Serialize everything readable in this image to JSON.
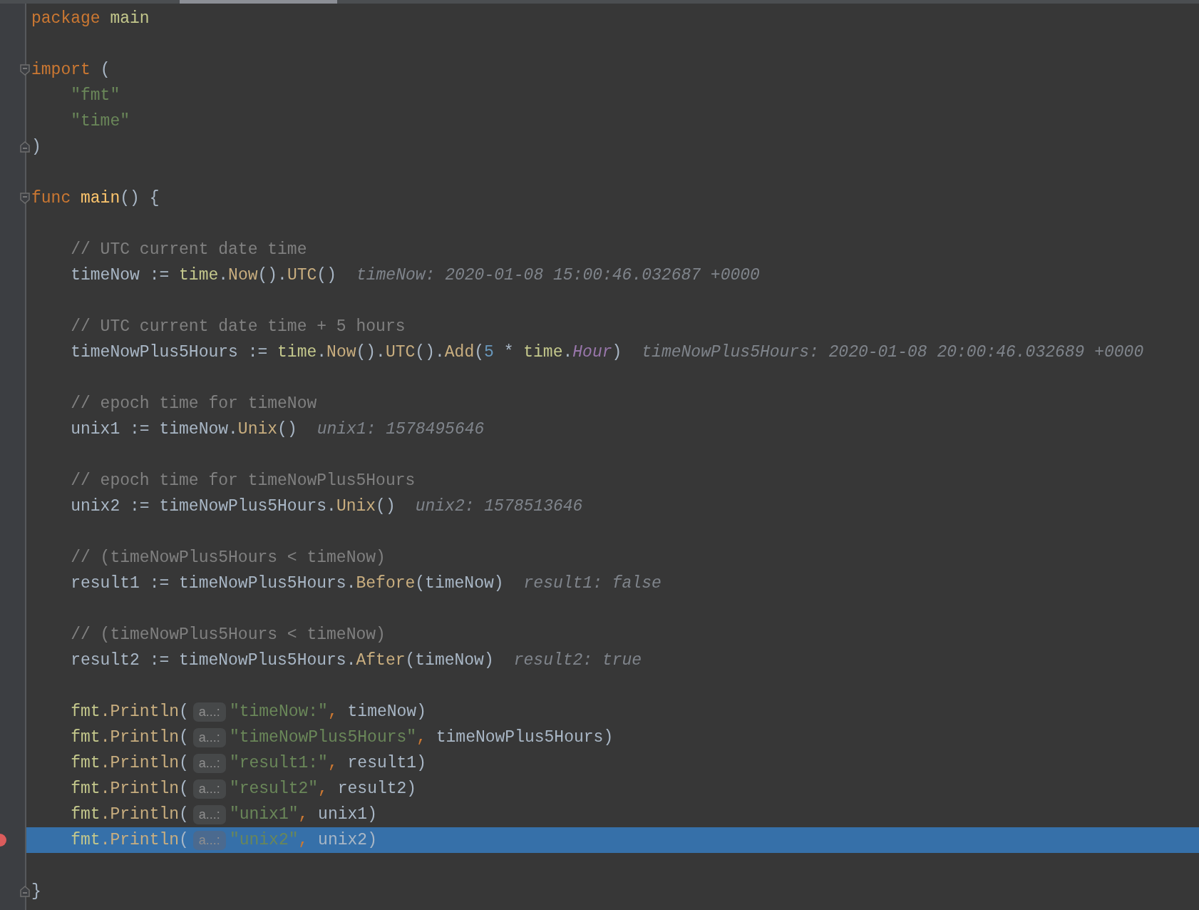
{
  "lines": [
    {
      "kind": "code",
      "current": false,
      "breakpoint": false,
      "segments": [
        {
          "kind": "code",
          "tokens": [
            {
              "kind": "keyword",
              "text": "package "
            },
            {
              "kind": "package",
              "text": "main"
            }
          ]
        }
      ]
    },
    {
      "kind": "blank"
    },
    {
      "kind": "code",
      "current": false,
      "breakpoint": false,
      "fold": {
        "kind": "start"
      },
      "segments": [
        {
          "kind": "code",
          "tokens": [
            {
              "kind": "keyword",
              "text": "import"
            },
            {
              "kind": "plain",
              "text": " ("
            }
          ]
        }
      ]
    },
    {
      "kind": "code",
      "current": false,
      "breakpoint": false,
      "segments": [
        {
          "kind": "code",
          "tokens": [
            {
              "kind": "string",
              "text": "    \"fmt\""
            }
          ]
        }
      ]
    },
    {
      "kind": "code",
      "current": false,
      "breakpoint": false,
      "segments": [
        {
          "kind": "code",
          "tokens": [
            {
              "kind": "string",
              "text": "    \"time\""
            }
          ]
        }
      ]
    },
    {
      "kind": "code",
      "current": false,
      "breakpoint": false,
      "fold": {
        "kind": "end"
      },
      "segments": [
        {
          "kind": "code",
          "tokens": [
            {
              "kind": "plain",
              "text": ")"
            }
          ]
        }
      ]
    },
    {
      "kind": "blank"
    },
    {
      "kind": "code",
      "current": false,
      "breakpoint": false,
      "fold": {
        "kind": "start"
      },
      "segments": [
        {
          "kind": "code",
          "tokens": [
            {
              "kind": "keyword",
              "text": "func "
            },
            {
              "kind": "function",
              "text": "main"
            },
            {
              "kind": "plain",
              "text": "() {"
            }
          ]
        }
      ]
    },
    {
      "kind": "blank"
    },
    {
      "kind": "code",
      "current": false,
      "breakpoint": false,
      "segments": [
        {
          "kind": "code",
          "tokens": [
            {
              "kind": "comment",
              "text": "    // UTC current date time"
            }
          ]
        }
      ]
    },
    {
      "kind": "code",
      "current": false,
      "breakpoint": false,
      "segments": [
        {
          "kind": "code",
          "tokens": [
            {
              "kind": "plain",
              "text": "    timeNow := "
            },
            {
              "kind": "package",
              "text": "time"
            },
            {
              "kind": "plain",
              "text": "."
            },
            {
              "kind": "method",
              "text": "Now"
            },
            {
              "kind": "plain",
              "text": "()."
            },
            {
              "kind": "method",
              "text": "UTC"
            },
            {
              "kind": "plain",
              "text": "()"
            }
          ]
        },
        {
          "kind": "value_hint",
          "text": "timeNow: 2020-01-08 15:00:46.032687 +0000"
        }
      ]
    },
    {
      "kind": "blank"
    },
    {
      "kind": "code",
      "current": false,
      "breakpoint": false,
      "segments": [
        {
          "kind": "code",
          "tokens": [
            {
              "kind": "comment",
              "text": "    // UTC current date time + 5 hours"
            }
          ]
        }
      ]
    },
    {
      "kind": "code",
      "current": false,
      "breakpoint": false,
      "segments": [
        {
          "kind": "code",
          "tokens": [
            {
              "kind": "plain",
              "text": "    timeNowPlus5Hours := "
            },
            {
              "kind": "package",
              "text": "time"
            },
            {
              "kind": "plain",
              "text": "."
            },
            {
              "kind": "method",
              "text": "Now"
            },
            {
              "kind": "plain",
              "text": "()."
            },
            {
              "kind": "method",
              "text": "UTC"
            },
            {
              "kind": "plain",
              "text": "()."
            },
            {
              "kind": "method",
              "text": "Add"
            },
            {
              "kind": "plain",
              "text": "("
            },
            {
              "kind": "number",
              "text": "5"
            },
            {
              "kind": "plain",
              "text": " * "
            },
            {
              "kind": "package",
              "text": "time"
            },
            {
              "kind": "plain",
              "text": "."
            },
            {
              "kind": "constant",
              "text": "Hour"
            },
            {
              "kind": "plain",
              "text": ")"
            }
          ]
        },
        {
          "kind": "value_hint",
          "text": "timeNowPlus5Hours: 2020-01-08 20:00:46.032689 +0000"
        }
      ]
    },
    {
      "kind": "blank"
    },
    {
      "kind": "code",
      "current": false,
      "breakpoint": false,
      "segments": [
        {
          "kind": "code",
          "tokens": [
            {
              "kind": "comment",
              "text": "    // epoch time for timeNow"
            }
          ]
        }
      ]
    },
    {
      "kind": "code",
      "current": false,
      "breakpoint": false,
      "segments": [
        {
          "kind": "code",
          "tokens": [
            {
              "kind": "plain",
              "text": "    unix1 := timeNow."
            },
            {
              "kind": "method",
              "text": "Unix"
            },
            {
              "kind": "plain",
              "text": "()"
            }
          ]
        },
        {
          "kind": "value_hint",
          "text": "unix1: 1578495646"
        }
      ]
    },
    {
      "kind": "blank"
    },
    {
      "kind": "code",
      "current": false,
      "breakpoint": false,
      "segments": [
        {
          "kind": "code",
          "tokens": [
            {
              "kind": "comment",
              "text": "    // epoch time for timeNowPlus5Hours"
            }
          ]
        }
      ]
    },
    {
      "kind": "code",
      "current": false,
      "breakpoint": false,
      "segments": [
        {
          "kind": "code",
          "tokens": [
            {
              "kind": "plain",
              "text": "    unix2 := timeNowPlus5Hours."
            },
            {
              "kind": "method",
              "text": "Unix"
            },
            {
              "kind": "plain",
              "text": "()"
            }
          ]
        },
        {
          "kind": "value_hint",
          "text": "unix2: 1578513646"
        }
      ]
    },
    {
      "kind": "blank"
    },
    {
      "kind": "code",
      "current": false,
      "breakpoint": false,
      "segments": [
        {
          "kind": "code",
          "tokens": [
            {
              "kind": "comment",
              "text": "    // (timeNowPlus5Hours < timeNow)"
            }
          ]
        }
      ]
    },
    {
      "kind": "code",
      "current": false,
      "breakpoint": false,
      "segments": [
        {
          "kind": "code",
          "tokens": [
            {
              "kind": "plain",
              "text": "    result1 := timeNowPlus5Hours."
            },
            {
              "kind": "method",
              "text": "Before"
            },
            {
              "kind": "plain",
              "text": "(timeNow)"
            }
          ]
        },
        {
          "kind": "value_hint",
          "text": "result1: false"
        }
      ]
    },
    {
      "kind": "blank"
    },
    {
      "kind": "code",
      "current": false,
      "breakpoint": false,
      "segments": [
        {
          "kind": "code",
          "tokens": [
            {
              "kind": "comment",
              "text": "    // (timeNowPlus5Hours < timeNow)"
            }
          ]
        }
      ]
    },
    {
      "kind": "code",
      "current": false,
      "breakpoint": false,
      "segments": [
        {
          "kind": "code",
          "tokens": [
            {
              "kind": "plain",
              "text": "    result2 := timeNowPlus5Hours."
            },
            {
              "kind": "method",
              "text": "After"
            },
            {
              "kind": "plain",
              "text": "(timeNow)"
            }
          ]
        },
        {
          "kind": "value_hint",
          "text": "result2: true"
        }
      ]
    },
    {
      "kind": "blank"
    },
    {
      "kind": "code",
      "current": false,
      "breakpoint": false,
      "segments": [
        {
          "kind": "code",
          "tokens": [
            {
              "kind": "package",
              "text": "    fmt"
            },
            {
              "kind": "method",
              "text": ".Println"
            },
            {
              "kind": "plain",
              "text": "("
            }
          ]
        },
        {
          "kind": "param_hint",
          "text": "a...:"
        },
        {
          "kind": "code",
          "tokens": [
            {
              "kind": "string",
              "text": "\"timeNow:\""
            },
            {
              "kind": "keyword",
              "text": ","
            },
            {
              "kind": "plain",
              "text": " timeNow)"
            }
          ]
        }
      ]
    },
    {
      "kind": "code",
      "current": false,
      "breakpoint": false,
      "segments": [
        {
          "kind": "code",
          "tokens": [
            {
              "kind": "package",
              "text": "    fmt"
            },
            {
              "kind": "method",
              "text": ".Println"
            },
            {
              "kind": "plain",
              "text": "("
            }
          ]
        },
        {
          "kind": "param_hint",
          "text": "a...:"
        },
        {
          "kind": "code",
          "tokens": [
            {
              "kind": "string",
              "text": "\"timeNowPlus5Hours\""
            },
            {
              "kind": "keyword",
              "text": ","
            },
            {
              "kind": "plain",
              "text": " timeNowPlus5Hours)"
            }
          ]
        }
      ]
    },
    {
      "kind": "code",
      "current": false,
      "breakpoint": false,
      "segments": [
        {
          "kind": "code",
          "tokens": [
            {
              "kind": "package",
              "text": "    fmt"
            },
            {
              "kind": "method",
              "text": ".Println"
            },
            {
              "kind": "plain",
              "text": "("
            }
          ]
        },
        {
          "kind": "param_hint",
          "text": "a...:"
        },
        {
          "kind": "code",
          "tokens": [
            {
              "kind": "string",
              "text": "\"result1:\""
            },
            {
              "kind": "keyword",
              "text": ","
            },
            {
              "kind": "plain",
              "text": " result1)"
            }
          ]
        }
      ]
    },
    {
      "kind": "code",
      "current": false,
      "breakpoint": false,
      "segments": [
        {
          "kind": "code",
          "tokens": [
            {
              "kind": "package",
              "text": "    fmt"
            },
            {
              "kind": "method",
              "text": ".Println"
            },
            {
              "kind": "plain",
              "text": "("
            }
          ]
        },
        {
          "kind": "param_hint",
          "text": "a...:"
        },
        {
          "kind": "code",
          "tokens": [
            {
              "kind": "string",
              "text": "\"result2\""
            },
            {
              "kind": "keyword",
              "text": ","
            },
            {
              "kind": "plain",
              "text": " result2)"
            }
          ]
        }
      ]
    },
    {
      "kind": "code",
      "current": false,
      "breakpoint": false,
      "segments": [
        {
          "kind": "code",
          "tokens": [
            {
              "kind": "package",
              "text": "    fmt"
            },
            {
              "kind": "method",
              "text": ".Println"
            },
            {
              "kind": "plain",
              "text": "("
            }
          ]
        },
        {
          "kind": "param_hint",
          "text": "a...:"
        },
        {
          "kind": "code",
          "tokens": [
            {
              "kind": "string",
              "text": "\"unix1\""
            },
            {
              "kind": "keyword",
              "text": ","
            },
            {
              "kind": "plain",
              "text": " unix1)"
            }
          ]
        }
      ]
    },
    {
      "kind": "code",
      "current": true,
      "breakpoint": true,
      "segments": [
        {
          "kind": "code",
          "tokens": [
            {
              "kind": "package",
              "text": "    fmt"
            },
            {
              "kind": "method",
              "text": ".Println"
            },
            {
              "kind": "plain",
              "text": "("
            }
          ]
        },
        {
          "kind": "param_hint",
          "text": "a...:"
        },
        {
          "kind": "code",
          "tokens": [
            {
              "kind": "string",
              "text": "\"unix2\""
            },
            {
              "kind": "keyword",
              "text": ","
            },
            {
              "kind": "plain",
              "text": " unix2)"
            }
          ]
        }
      ]
    },
    {
      "kind": "blank"
    },
    {
      "kind": "code",
      "current": false,
      "breakpoint": false,
      "fold": {
        "kind": "end"
      },
      "segments": [
        {
          "kind": "code",
          "tokens": [
            {
              "kind": "plain",
              "text": "}"
            }
          ]
        }
      ]
    }
  ]
}
